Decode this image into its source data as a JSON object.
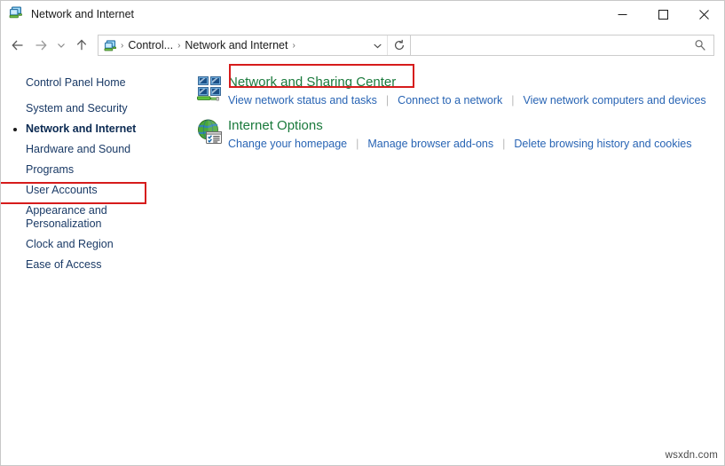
{
  "window": {
    "title": "Network and Internet",
    "title_icon": "network-control-panel-icon",
    "minimize_label": "Minimize",
    "maximize_label": "Maximize",
    "close_label": "Close"
  },
  "navbar": {
    "back_label": "Back",
    "forward_label": "Forward",
    "recent_label": "Recent locations",
    "up_label": "Up",
    "breadcrumbs": [
      {
        "label": "Control...",
        "truncated": true
      },
      {
        "label": "Network and Internet",
        "truncated": false
      }
    ],
    "breadcrumb_separator": "›",
    "dropdown_label": "Previous locations",
    "refresh_label": "Refresh",
    "search": {
      "value": "",
      "placeholder": "",
      "icon": "search-icon"
    }
  },
  "sidebar": {
    "items": [
      {
        "label": "Control Panel Home",
        "active": false,
        "bullet": false
      },
      {
        "label": "System and Security",
        "active": false,
        "bullet": false
      },
      {
        "label": "Network and Internet",
        "active": true,
        "bullet": true
      },
      {
        "label": "Hardware and Sound",
        "active": false,
        "bullet": false
      },
      {
        "label": "Programs",
        "active": false,
        "bullet": false
      },
      {
        "label": "User Accounts",
        "active": false,
        "bullet": false
      },
      {
        "label": "Appearance and\nPersonalization",
        "active": false,
        "bullet": false
      },
      {
        "label": "Clock and Region",
        "active": false,
        "bullet": false
      },
      {
        "label": "Ease of Access",
        "active": false,
        "bullet": false
      }
    ]
  },
  "main": {
    "categories": [
      {
        "title": "Network and Sharing Center",
        "icon": "network-sharing-center-icon",
        "highlighted": true,
        "links": [
          "View network status and tasks",
          "Connect to a network",
          "View network computers and devices"
        ]
      },
      {
        "title": "Internet Options",
        "icon": "internet-options-globe-icon",
        "highlighted": false,
        "links": [
          "Change your homepage",
          "Manage browser add-ons",
          "Delete browsing history and cookies"
        ]
      }
    ]
  },
  "watermark": {
    "text": "wsxdn.com"
  },
  "colors": {
    "category_title": "#1a7a3c",
    "link": "#2864b4",
    "sidebar_text": "#1a3a66",
    "highlight_box": "#d61c1c",
    "window_bg": "#ffffff"
  }
}
